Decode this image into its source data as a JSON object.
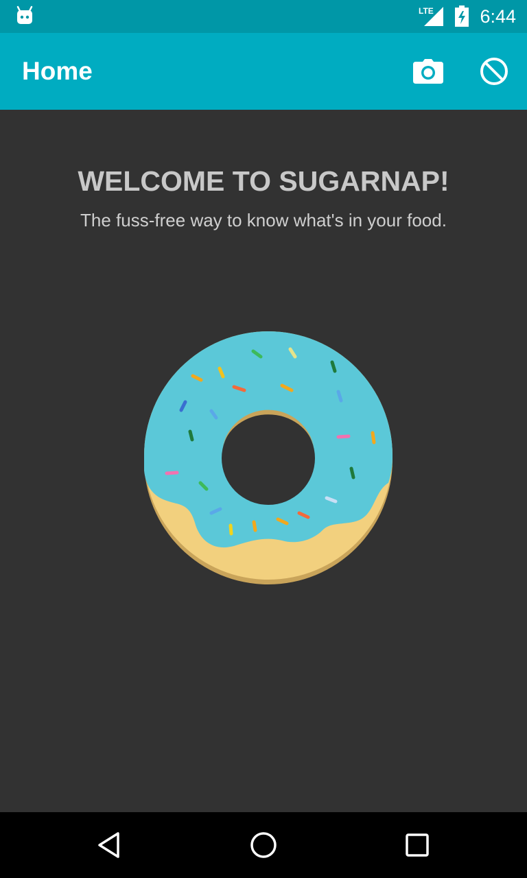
{
  "status_bar": {
    "network_label": "LTE",
    "time": "6:44",
    "icons": [
      "android-icon",
      "lte-signal-icon",
      "battery-icon"
    ]
  },
  "app_bar": {
    "title": "Home",
    "actions": [
      "camera-icon",
      "block-icon"
    ]
  },
  "main": {
    "welcome_title": "WELCOME TO SUGARNAP!",
    "welcome_subtitle": "The fuss-free way to know what's in your food.",
    "illustration": "donut-illustration"
  },
  "nav_bar": {
    "buttons": [
      "back-icon",
      "home-icon",
      "recents-icon"
    ]
  },
  "colors": {
    "status_bar": "#0097a7",
    "app_bar": "#00acc1",
    "background": "#323232",
    "frosting": "#5bc8d8",
    "dough": "#f2d07e",
    "dough_shadow": "#c9a45a"
  }
}
